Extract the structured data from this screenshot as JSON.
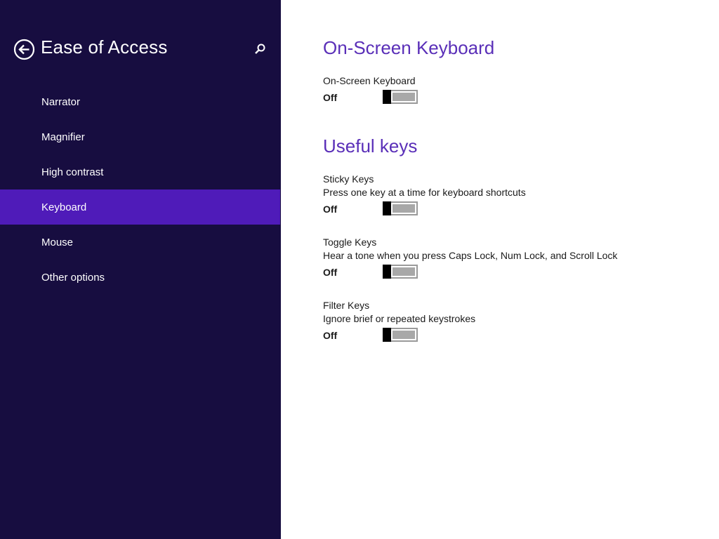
{
  "sidebar": {
    "title": "Ease of Access",
    "back_icon": "back-arrow-icon",
    "search_icon": "search-icon",
    "items": [
      {
        "label": "Narrator"
      },
      {
        "label": "Magnifier"
      },
      {
        "label": "High contrast"
      },
      {
        "label": "Keyboard",
        "active": true
      },
      {
        "label": "Mouse"
      },
      {
        "label": "Other options"
      }
    ]
  },
  "content": {
    "sections": [
      {
        "title": "On-Screen Keyboard",
        "settings": [
          {
            "label": "On-Screen Keyboard",
            "description": "",
            "state": "Off"
          }
        ]
      },
      {
        "title": "Useful keys",
        "settings": [
          {
            "label": "Sticky Keys",
            "description": "Press one key at a time for keyboard shortcuts",
            "state": "Off"
          },
          {
            "label": "Toggle Keys",
            "description": "Hear a tone when you press Caps Lock, Num Lock, and Scroll Lock",
            "state": "Off"
          },
          {
            "label": "Filter Keys",
            "description": "Ignore brief or repeated keystrokes",
            "state": "Off"
          }
        ]
      }
    ]
  },
  "colors": {
    "sidebar_bg": "#170d40",
    "active_item_bg": "#4f1bb9",
    "section_title": "#5a2fb8",
    "toggle_track": "#a8a8a8"
  }
}
